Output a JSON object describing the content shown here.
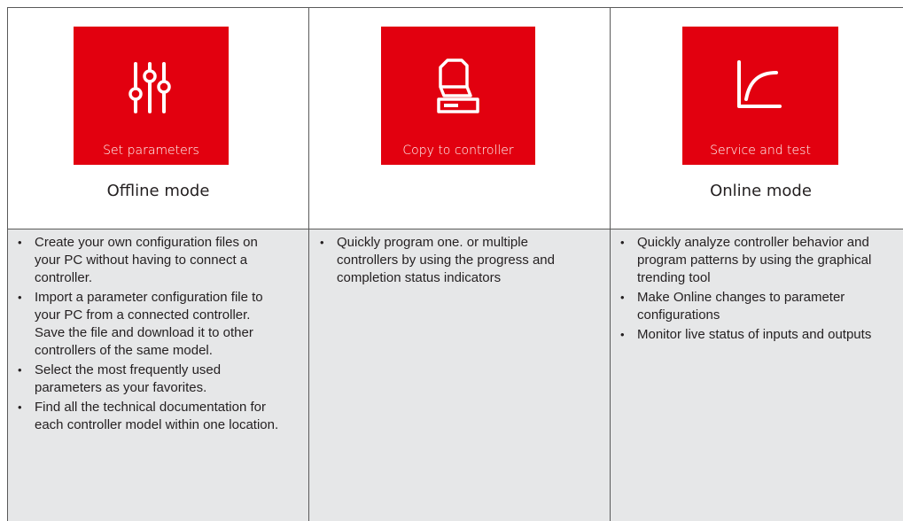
{
  "columns": [
    {
      "tile_caption": "Set parameters",
      "icon": "sliders-icon",
      "mode_label": "Offline mode",
      "bullets": [
        "Create your own configuration files on your PC without having to connect a controller.",
        "Import a parameter configuration file to your PC from a connected controller. Save the file and download it to other controllers of the same model.",
        "Select the most frequently used parameters as your favorites.",
        "Find all the technical documentation for each controller model within one location."
      ]
    },
    {
      "tile_caption": "Copy to  controller",
      "icon": "copy-to-controller-icon",
      "mode_label": "",
      "bullets": [
        "Quickly program one. or multiple controllers by using the progress and completion status indicators"
      ]
    },
    {
      "tile_caption": "Service and test",
      "icon": "trend-curve-icon",
      "mode_label": "Online mode",
      "bullets": [
        "Quickly analyze controller behavior and program patterns by using the graphical trending tool",
        "Make Online changes to parameter configurations",
        "Monitor live status of inputs and outputs"
      ]
    }
  ],
  "colors": {
    "tile_red": "#e2000f",
    "panel_gray": "#e6e7e8",
    "border": "#5a5a5a"
  }
}
